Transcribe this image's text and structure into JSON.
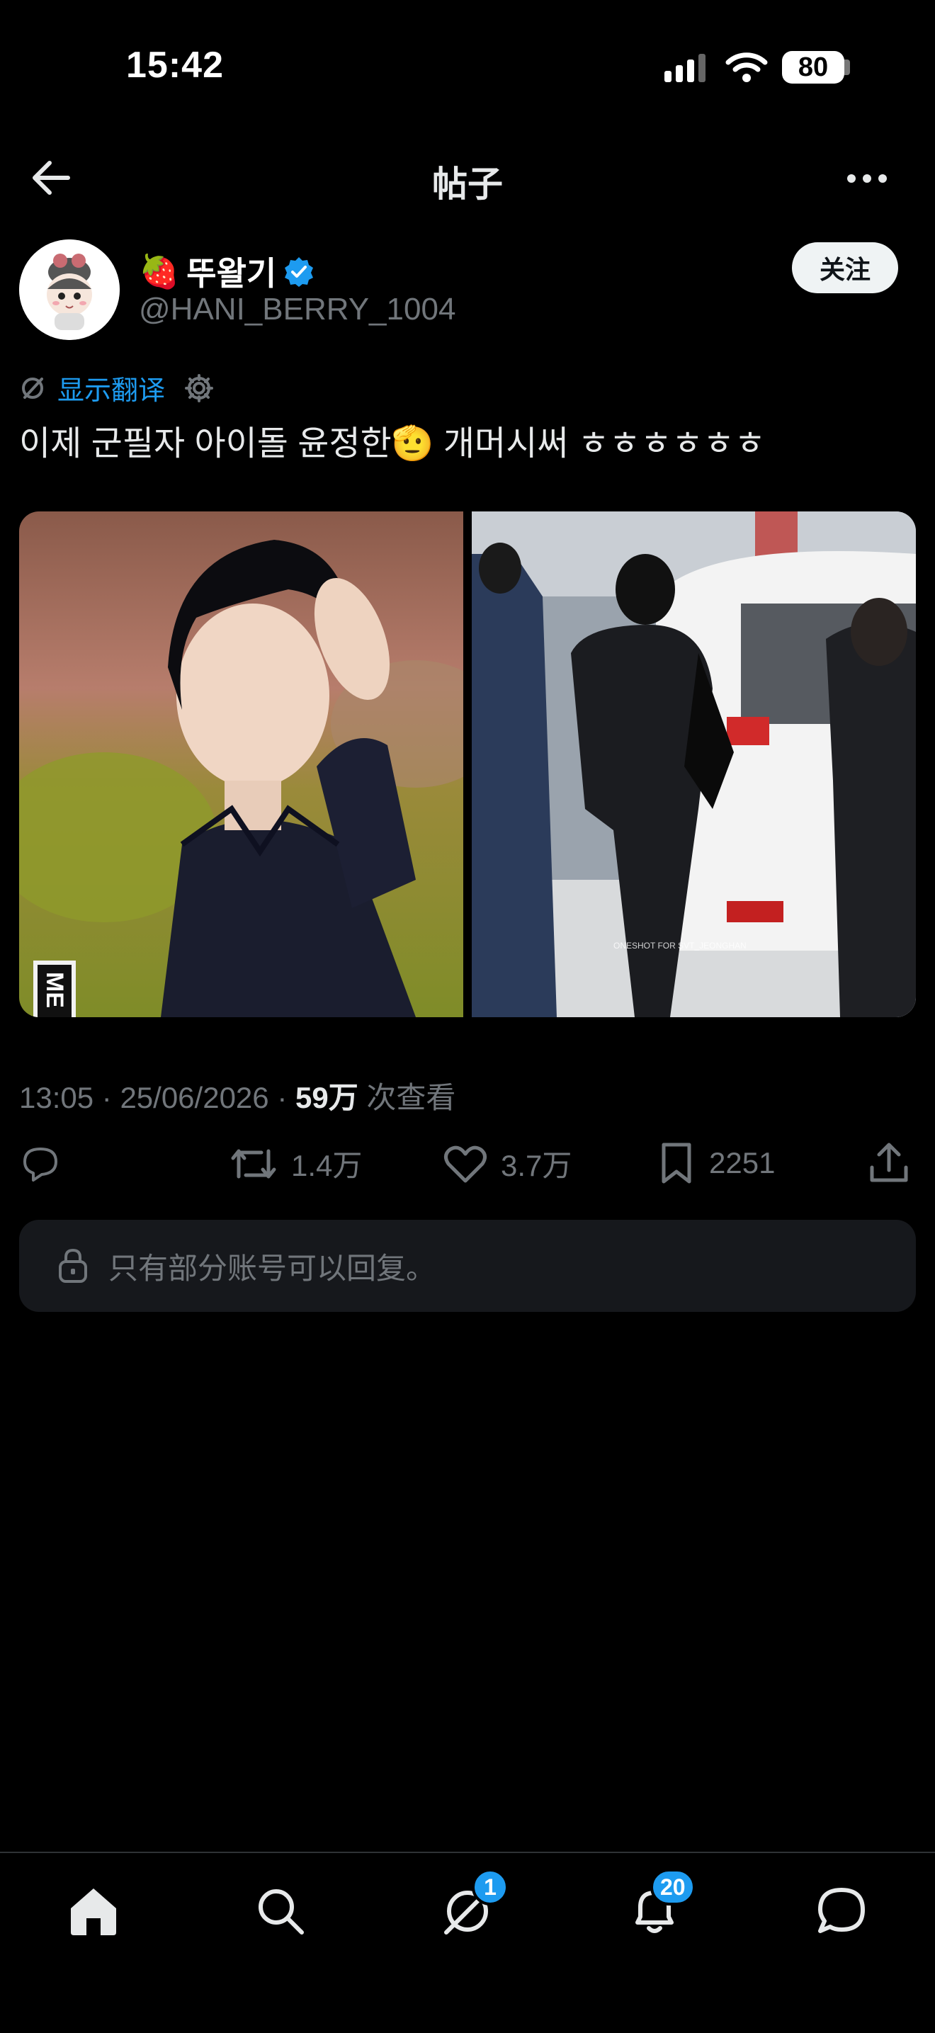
{
  "status_bar": {
    "time": "15:42",
    "battery": "80"
  },
  "header": {
    "title": "帖子"
  },
  "post": {
    "author_emoji": "🍓",
    "author_name": "뚜왈기",
    "handle": "@HANI_BERRY_1004",
    "follow_label": "关注",
    "translate_label": "显示翻译",
    "text": "이제 군필자 아이돌 윤정한🫡 개머시써 ㅎㅎㅎㅎㅎㅎ",
    "photo2_watermark": "ONESHOT   FOR SVT_JEONGHAN",
    "photo1_sign": "ME",
    "time": "13:05",
    "date": "25/06/2026",
    "views": "59万",
    "views_label": "次查看",
    "retweets": "1.4万",
    "likes": "3.7万",
    "bookmarks": "2251",
    "reply_restriction": "只有部分账号可以回复。"
  },
  "tabbar": {
    "messages_badge": "1",
    "notifications_badge": "20"
  },
  "colors": {
    "accent": "#1d9bf0",
    "background": "#000000",
    "muted": "#71767b"
  }
}
